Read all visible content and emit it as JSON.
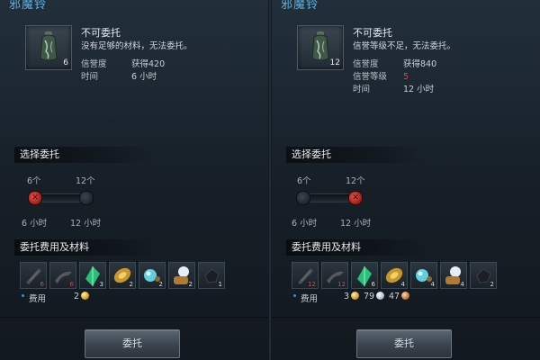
{
  "panels": [
    {
      "title": "邪魔铃",
      "item_count": "6",
      "status_title": "不可委托",
      "status_desc": "没有足够的材料，无法委托。",
      "rows": [
        {
          "label": "信誉度",
          "value": "获得420"
        },
        {
          "label": "时间",
          "value": "6 小时"
        }
      ],
      "select_header": "选择委托",
      "slider": {
        "top_labels": [
          "6个",
          "12个"
        ],
        "bottom_labels": [
          "6 小时",
          "12 小时"
        ],
        "selected_index": 0,
        "knob_marks": [
          "✕",
          ""
        ]
      },
      "materials_header": "委托费用及材料",
      "materials": [
        {
          "icon": "dark-blade-icon",
          "count": "6"
        },
        {
          "icon": "dark-dagger-icon",
          "count": "6"
        },
        {
          "icon": "green-crystal-icon",
          "count": "3"
        },
        {
          "icon": "gold-ornament-icon",
          "count": "2"
        },
        {
          "icon": "cyan-gem-icon",
          "count": "2"
        },
        {
          "icon": "orb-pot-icon",
          "count": "2"
        },
        {
          "icon": "black-fragment-icon",
          "count": "1"
        }
      ],
      "cost_label": "费用",
      "cost": [
        {
          "amount": "2",
          "coin": "gold"
        }
      ],
      "button": "委托"
    },
    {
      "title": "邪魔铃",
      "item_count": "12",
      "status_title": "不可委托",
      "status_desc": "信誉等级不足，无法委托。",
      "rows": [
        {
          "label": "信誉度",
          "value": "获得840"
        },
        {
          "label": "信誉等级",
          "value": "5",
          "red": true
        },
        {
          "label": "时间",
          "value": "12 小时"
        }
      ],
      "select_header": "选择委托",
      "slider": {
        "top_labels": [
          "6个",
          "12个"
        ],
        "bottom_labels": [
          "6 小时",
          "12 小时"
        ],
        "selected_index": 1,
        "knob_marks": [
          "",
          "✕"
        ]
      },
      "materials_header": "委托费用及材料",
      "materials": [
        {
          "icon": "dark-blade-icon",
          "count": "12"
        },
        {
          "icon": "dark-dagger-icon",
          "count": "12"
        },
        {
          "icon": "green-crystal-icon",
          "count": "6"
        },
        {
          "icon": "gold-ornament-icon",
          "count": "4"
        },
        {
          "icon": "cyan-gem-icon",
          "count": "4"
        },
        {
          "icon": "orb-pot-icon",
          "count": "4"
        },
        {
          "icon": "black-fragment-icon",
          "count": "2"
        }
      ],
      "cost_label": "费用",
      "cost": [
        {
          "amount": "3",
          "coin": "gold"
        },
        {
          "amount": "79",
          "coin": "silver"
        },
        {
          "amount": "47",
          "coin": "copper"
        }
      ],
      "button": "委托"
    }
  ],
  "colors": {
    "title_blue": "#5fb2e6",
    "warning_red": "#e0443c",
    "knob_red": "#c0302a"
  }
}
